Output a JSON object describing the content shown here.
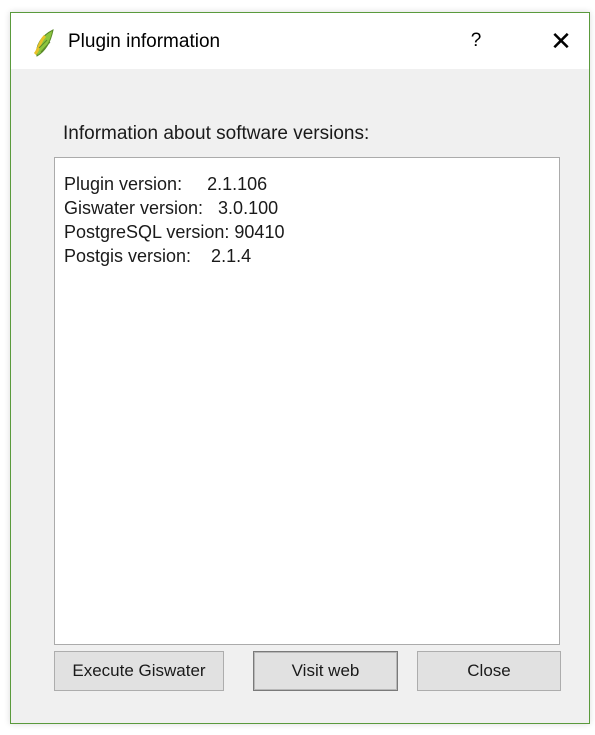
{
  "window": {
    "title": "Plugin information",
    "help_label": "?",
    "close_label": "✕"
  },
  "main": {
    "heading": "Information about software versions:",
    "lines": [
      "Plugin version:     2.1.106",
      "Giswater version:   3.0.100",
      "PostgreSQL version: 90410",
      "Postgis version:    2.1.4"
    ]
  },
  "buttons": {
    "execute_label": "Execute Giswater",
    "visit_label": "Visit web",
    "close_label": "Close"
  },
  "icons": {
    "app": "qgis-leaf-icon"
  },
  "colors": {
    "window_border": "#5a9a3c",
    "leaf_green": "#8cc63e",
    "leaf_yellow": "#e8c229"
  }
}
